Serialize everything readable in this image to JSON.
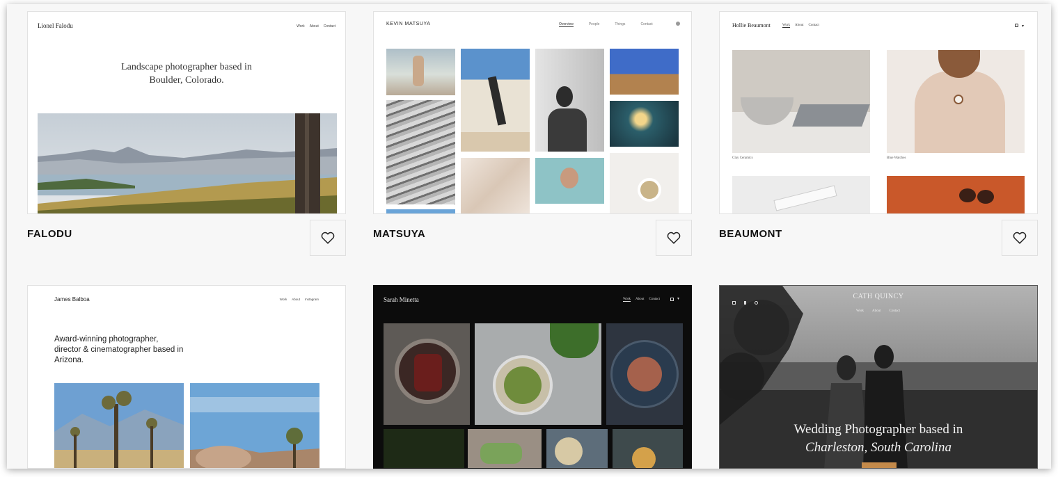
{
  "templates": [
    {
      "name": "FALODU",
      "site_name": "Lionel Falodu",
      "nav": [
        "Work",
        "About",
        "Contact"
      ],
      "headline_line1": "Landscape photographer based in",
      "headline_line2": "Boulder, Colorado."
    },
    {
      "name": "MATSUYA",
      "site_name": "KEVIN MATSUYA",
      "nav": [
        "Overview",
        "People",
        "Things",
        "Contact"
      ]
    },
    {
      "name": "BEAUMONT",
      "site_name": "Hollie Beaumont",
      "nav": [
        "Work",
        "About",
        "Contact"
      ],
      "captions": [
        "Clay Ceramics",
        "Blue Watches"
      ]
    },
    {
      "name": "",
      "site_name": "James Balboa",
      "nav": [
        "Work",
        "About",
        "Instagram"
      ],
      "headline_line1": "Award-winning photographer,",
      "headline_line2": "director & cinematographer based in",
      "headline_line3": "Arizona."
    },
    {
      "name": "",
      "site_name": "Sarah Minetta",
      "nav": [
        "Work",
        "About",
        "Contact"
      ]
    },
    {
      "name": "",
      "site_name": "CATH QUINCY",
      "nav": [
        "Work",
        "About",
        "Contact"
      ],
      "headline_line1": "Wedding Photographer based in",
      "headline_line2": "Charleston, South Carolina"
    }
  ],
  "icons": {
    "favorite": "heart-outline-icon",
    "social": [
      "instagram-icon",
      "twitter-icon",
      "facebook-icon"
    ]
  }
}
